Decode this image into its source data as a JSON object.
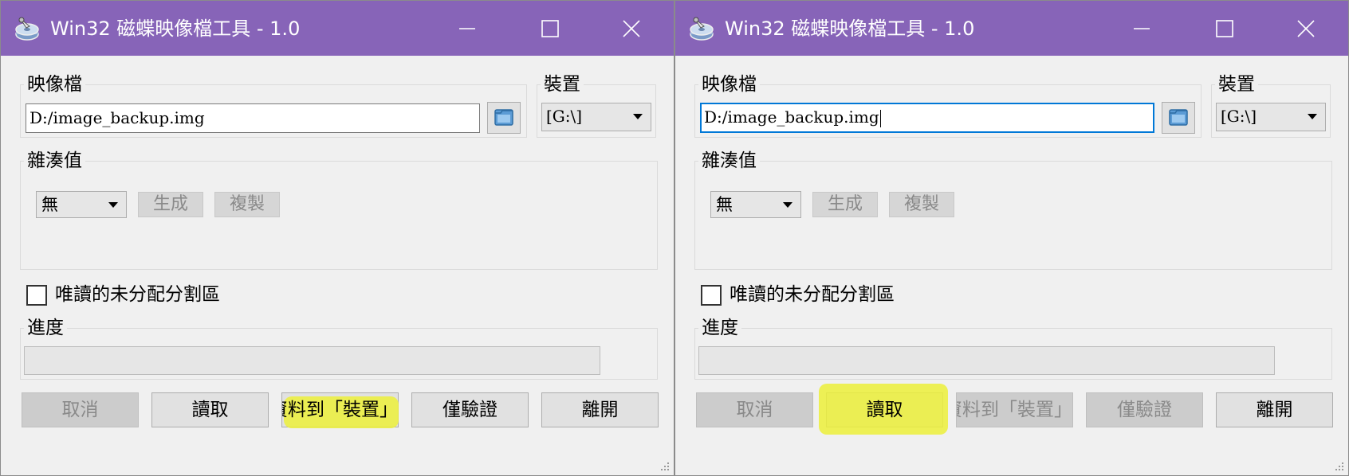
{
  "windows": [
    {
      "title": "Win32 磁蝶映像檔工具 - 1.0",
      "image_file_label": "映像檔",
      "image_file_value": "D:/image_backup.img",
      "device_label": "裝置",
      "device_value": "[G:\\]",
      "hash_label": "雜湊值",
      "hash_type": "無",
      "generate_label": "生成",
      "copy_label": "複製",
      "readonly_label": "唯讀的未分配分割區",
      "progress_label": "進度",
      "progress_value": 0,
      "buttons": {
        "cancel": "取消",
        "read": "讀取",
        "write": "寫入資料到「裝置」",
        "verify": "僅驗證",
        "exit": "離開"
      }
    },
    {
      "title": "Win32 磁蝶映像檔工具 - 1.0",
      "image_file_label": "映像檔",
      "image_file_value": "D:/image_backup.img",
      "device_label": "裝置",
      "device_value": "[G:\\]",
      "hash_label": "雜湊值",
      "hash_type": "無",
      "generate_label": "生成",
      "copy_label": "複製",
      "readonly_label": "唯讀的未分配分割區",
      "progress_label": "進度",
      "progress_value": 0,
      "buttons": {
        "cancel": "取消",
        "read": "讀取",
        "write": "寫入資料到「裝置」",
        "verify": "僅驗證",
        "exit": "離開"
      }
    }
  ],
  "colors": {
    "titlebar": "#8764b8",
    "highlight": "#ecf03a",
    "focus_border": "#0078d7"
  }
}
